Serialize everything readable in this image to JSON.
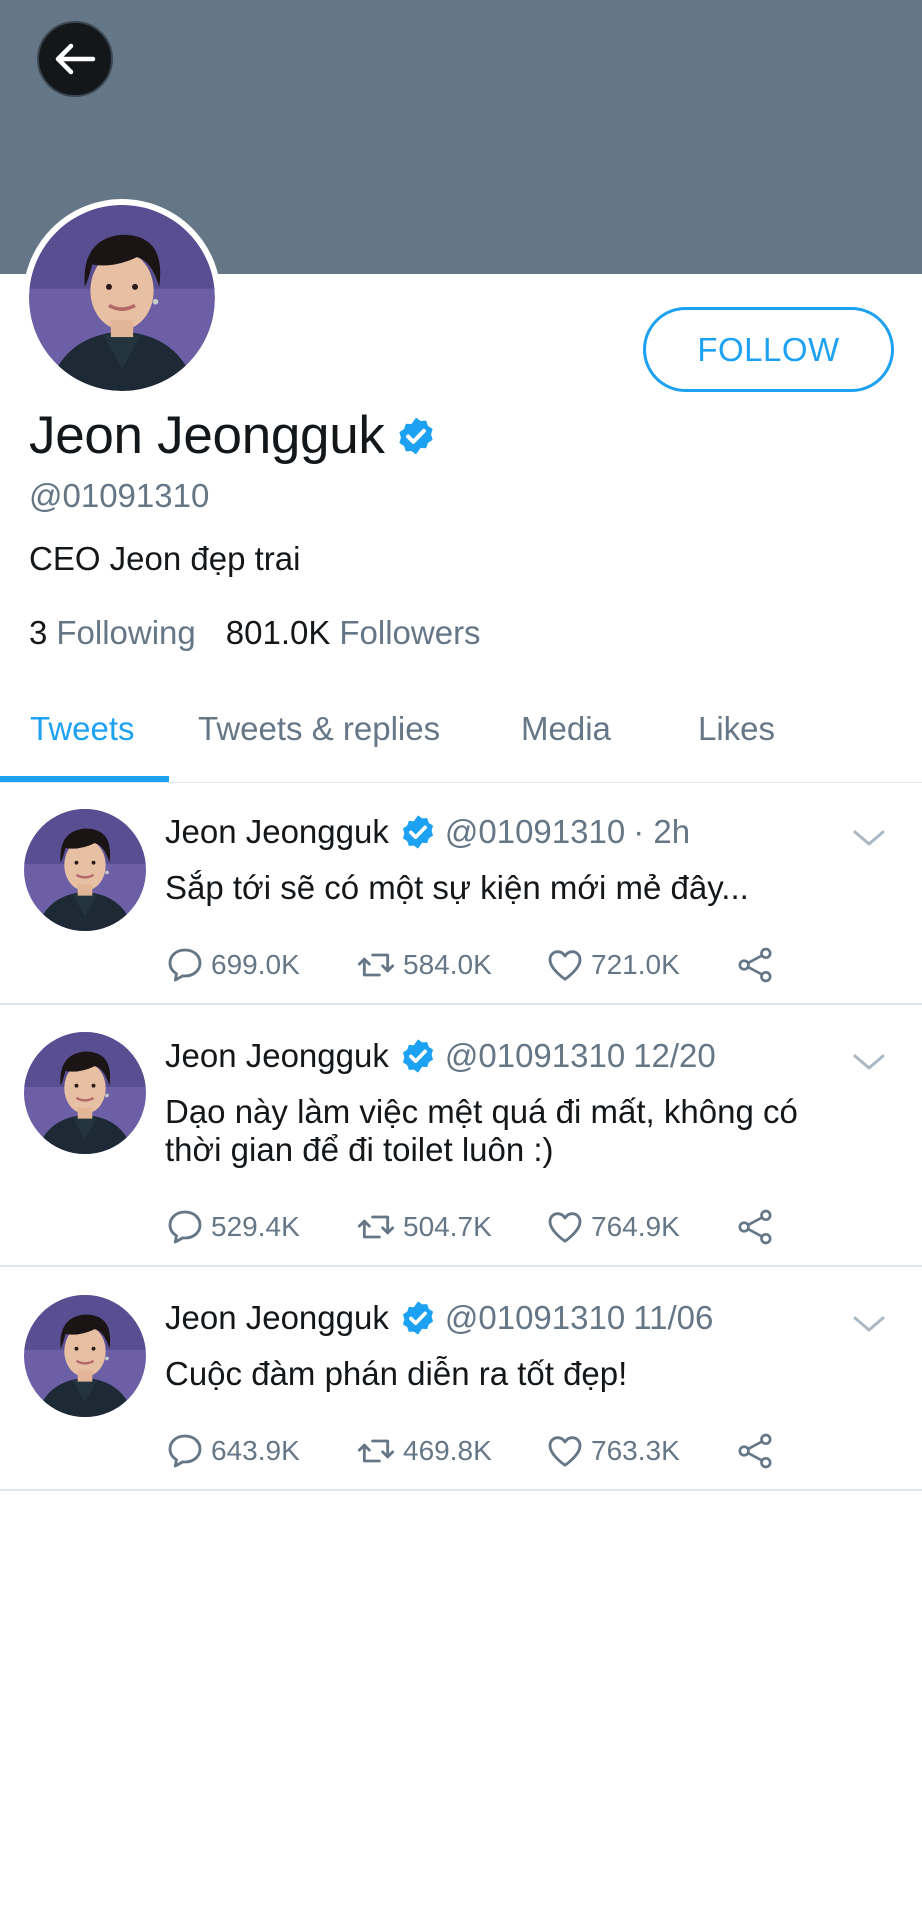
{
  "colors": {
    "banner": "#657786",
    "accent": "#1da1f2",
    "text": "#14171a",
    "secondary": "#657786",
    "divider": "#e1e8ed"
  },
  "profile": {
    "display_name": "Jeon Jeongguk",
    "handle": "@01091310",
    "bio": "CEO Jeon đẹp trai",
    "following_count": "3",
    "following_label": "Following",
    "followers_count": "801.0K",
    "followers_label": "Followers",
    "follow_button": "FOLLOW"
  },
  "tabs": [
    {
      "label": "Tweets",
      "active": true
    },
    {
      "label": "Tweets & replies",
      "active": false
    },
    {
      "label": "Media",
      "active": false
    },
    {
      "label": "Likes",
      "active": false
    }
  ],
  "tweets": [
    {
      "name": "Jeon Jeongguk",
      "handle": "@01091310",
      "time": "· 2h",
      "lines": [
        "Sắp tới sẽ có một sự kiện mới mẻ đây..."
      ],
      "replies": "699.0K",
      "retweets": "584.0K",
      "likes": "721.0K"
    },
    {
      "name": "Jeon Jeongguk",
      "handle": "@01091310",
      "time": "12/20",
      "lines": [
        "Dạo này làm việc mệt quá đi mất, không có",
        "thời gian để đi toilet luôn :)"
      ],
      "replies": "529.4K",
      "retweets": "504.7K",
      "likes": "764.9K"
    },
    {
      "name": "Jeon Jeongguk",
      "handle": "@01091310",
      "time": "11/06",
      "lines": [
        "Cuộc đàm phán diễn ra tốt đẹp!"
      ],
      "replies": "643.9K",
      "retweets": "469.8K",
      "likes": "763.3K"
    }
  ]
}
